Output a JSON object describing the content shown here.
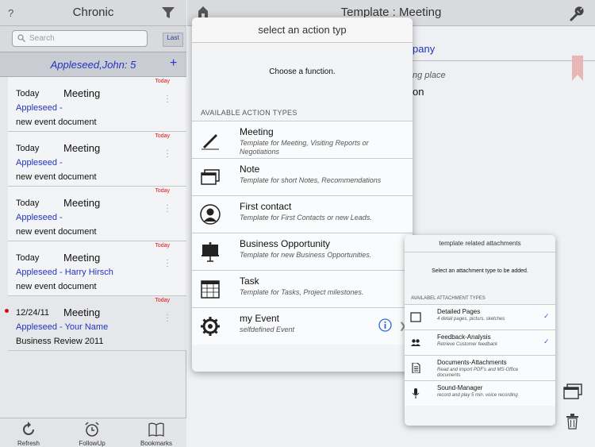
{
  "left": {
    "help": "?",
    "title": "Chronic",
    "search_placeholder": "Search",
    "last_label": "Last",
    "contact": "Appleseed,John: 5",
    "add": "+",
    "events": [
      {
        "badge": "Today",
        "date": "Today",
        "type": "Meeting",
        "person": "Appleseed -",
        "doc": "new event document"
      },
      {
        "badge": "Today",
        "date": "Today",
        "type": "Meeting",
        "person": "Appleseed -",
        "doc": "new event document"
      },
      {
        "badge": "Today",
        "date": "Today",
        "type": "Meeting",
        "person": "Appleseed -",
        "doc": "new event document"
      },
      {
        "badge": "Today",
        "date": "Today",
        "type": "Meeting",
        "person": "Appleseed - Harry Hirsch",
        "doc": "new event document"
      },
      {
        "badge": "Today",
        "date": "12/24/11",
        "type": "Meeting",
        "person": "Appleseed - Your Name",
        "doc": "Business Review  2011"
      }
    ],
    "tabs": [
      {
        "label": "Refresh",
        "icon": "refresh-icon"
      },
      {
        "label": "FollowUp",
        "icon": "alarm-clock-icon"
      },
      {
        "label": "Bookmarks",
        "icon": "book-icon"
      }
    ]
  },
  "right": {
    "title": "Template : Meeting",
    "field1": "pany",
    "field2": "ng place",
    "field3": "on"
  },
  "action_popover": {
    "title": "select an action typ",
    "prompt": "Choose a function.",
    "section": "AVAILABLE ACTION TYPES",
    "items": [
      {
        "name": "Meeting",
        "desc": "Template for Meeting, Visiting Reports or Negotiations",
        "icon": "pen-icon"
      },
      {
        "name": "Note",
        "desc": "Template for short Notes, Recommendations",
        "icon": "note-windows-icon"
      },
      {
        "name": "First contact",
        "desc": "Template for First Contacts or new Leads.",
        "icon": "person-icon"
      },
      {
        "name": "Business Opportunity",
        "desc": "Template for new Business Opportunities.",
        "icon": "presentation-board-icon"
      },
      {
        "name": "Task",
        "desc": "Template for Tasks, Project milestones.",
        "icon": "calendar-icon"
      },
      {
        "name": "my Event",
        "desc": "selfdefined Event",
        "icon": "gear-icon"
      }
    ]
  },
  "attach_popover": {
    "title": "template related attachments",
    "prompt": "Select an attachment type to be added.",
    "section": "AVAILABEL ATTACHMENT TYPES",
    "items": [
      {
        "name": "Detailed Pages",
        "desc": "4 detail pages, picturs, sketches",
        "checked": "✓",
        "icon": "page-icon"
      },
      {
        "name": "Feedback-Analysis",
        "desc": "Retrieve Customer feedback",
        "checked": "✓",
        "icon": "people-icon"
      },
      {
        "name": "Documents-Attachments",
        "desc": "Read and import PDF's and MS-Office documents",
        "checked": "",
        "icon": "document-icon"
      },
      {
        "name": "Sound-Manager",
        "desc": "record and play 5 min. voice recording",
        "checked": "",
        "icon": "microphone-icon"
      }
    ]
  }
}
